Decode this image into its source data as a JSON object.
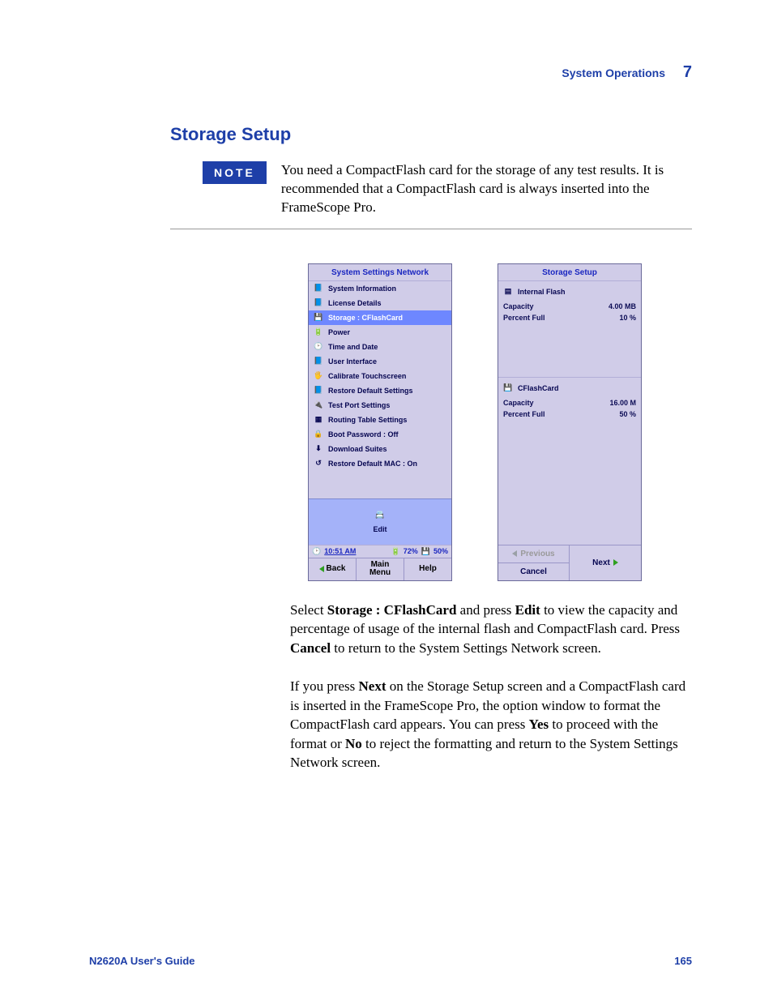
{
  "header": {
    "section": "System Operations",
    "chapter": "7"
  },
  "title": "Storage Setup",
  "note": {
    "label": "NOTE",
    "text": "You need a CompactFlash card for the storage of any test results. It is recommended that a CompactFlash card is always inserted into the FrameScope Pro."
  },
  "left_screen": {
    "title": "System Settings Network",
    "items": [
      {
        "label": "System Information",
        "icon": "book-icon"
      },
      {
        "label": "License Details",
        "icon": "book-icon"
      },
      {
        "label": "Storage : CFlashCard",
        "icon": "card-icon",
        "selected": true
      },
      {
        "label": "Power",
        "icon": "battery-icon"
      },
      {
        "label": "Time and Date",
        "icon": "clock-icon"
      },
      {
        "label": "User Interface",
        "icon": "book-icon"
      },
      {
        "label": "Calibrate Touchscreen",
        "icon": "touch-icon"
      },
      {
        "label": "Restore Default Settings",
        "icon": "book-icon"
      },
      {
        "label": "Test Port Settings",
        "icon": "port-icon"
      },
      {
        "label": "Routing Table Settings",
        "icon": "table-icon"
      },
      {
        "label": "Boot Password : Off",
        "icon": "lock-icon"
      },
      {
        "label": "Download Suites",
        "icon": "download-icon"
      },
      {
        "label": "Restore Default MAC : On",
        "icon": "mac-icon"
      }
    ],
    "edit_label": "Edit",
    "status": {
      "time": "10:51 AM",
      "battery": "72%",
      "storage": "50%"
    },
    "nav": {
      "back": "Back",
      "main": "Main Menu",
      "help": "Help"
    }
  },
  "right_screen": {
    "title": "Storage Setup",
    "internal": {
      "name": "Internal Flash",
      "capacity_label": "Capacity",
      "capacity_value": "4.00 MB",
      "percent_label": "Percent Full",
      "percent_value": "10 %"
    },
    "cflash": {
      "name": "CFlashCard",
      "capacity_label": "Capacity",
      "capacity_value": "16.00 M",
      "percent_label": "Percent Full",
      "percent_value": "50 %"
    },
    "nav": {
      "previous": "Previous",
      "next": "Next",
      "cancel": "Cancel"
    }
  },
  "para1": {
    "t1": "Select ",
    "b1": "Storage : CFlashCard",
    "t2": " and press ",
    "b2": "Edit",
    "t3": " to view the capacity and percentage of usage of the internal flash and CompactFlash card. Press ",
    "b3": "Cancel",
    "t4": " to return to the System Settings Network screen."
  },
  "para2": {
    "t1": "If you press ",
    "b1": "Next",
    "t2": " on the Storage Setup screen and a CompactFlash card is inserted in the FrameScope Pro, the option window to format the CompactFlash card appears. You can press ",
    "b2": "Yes",
    "t3": " to proceed with the format or ",
    "b3": "No",
    "t4": " to reject the formatting and return to the System Settings Network screen."
  },
  "footer": {
    "guide": "N2620A User's Guide",
    "page": "165"
  },
  "icons": {
    "book-icon": "📘",
    "card-icon": "💾",
    "battery-icon": "🔋",
    "clock-icon": "🕑",
    "touch-icon": "🖐",
    "port-icon": "🔌",
    "table-icon": "▦",
    "lock-icon": "🔒",
    "download-icon": "⬇",
    "mac-icon": "↺",
    "chip-icon": "▤",
    "edit-icon": "📇"
  }
}
